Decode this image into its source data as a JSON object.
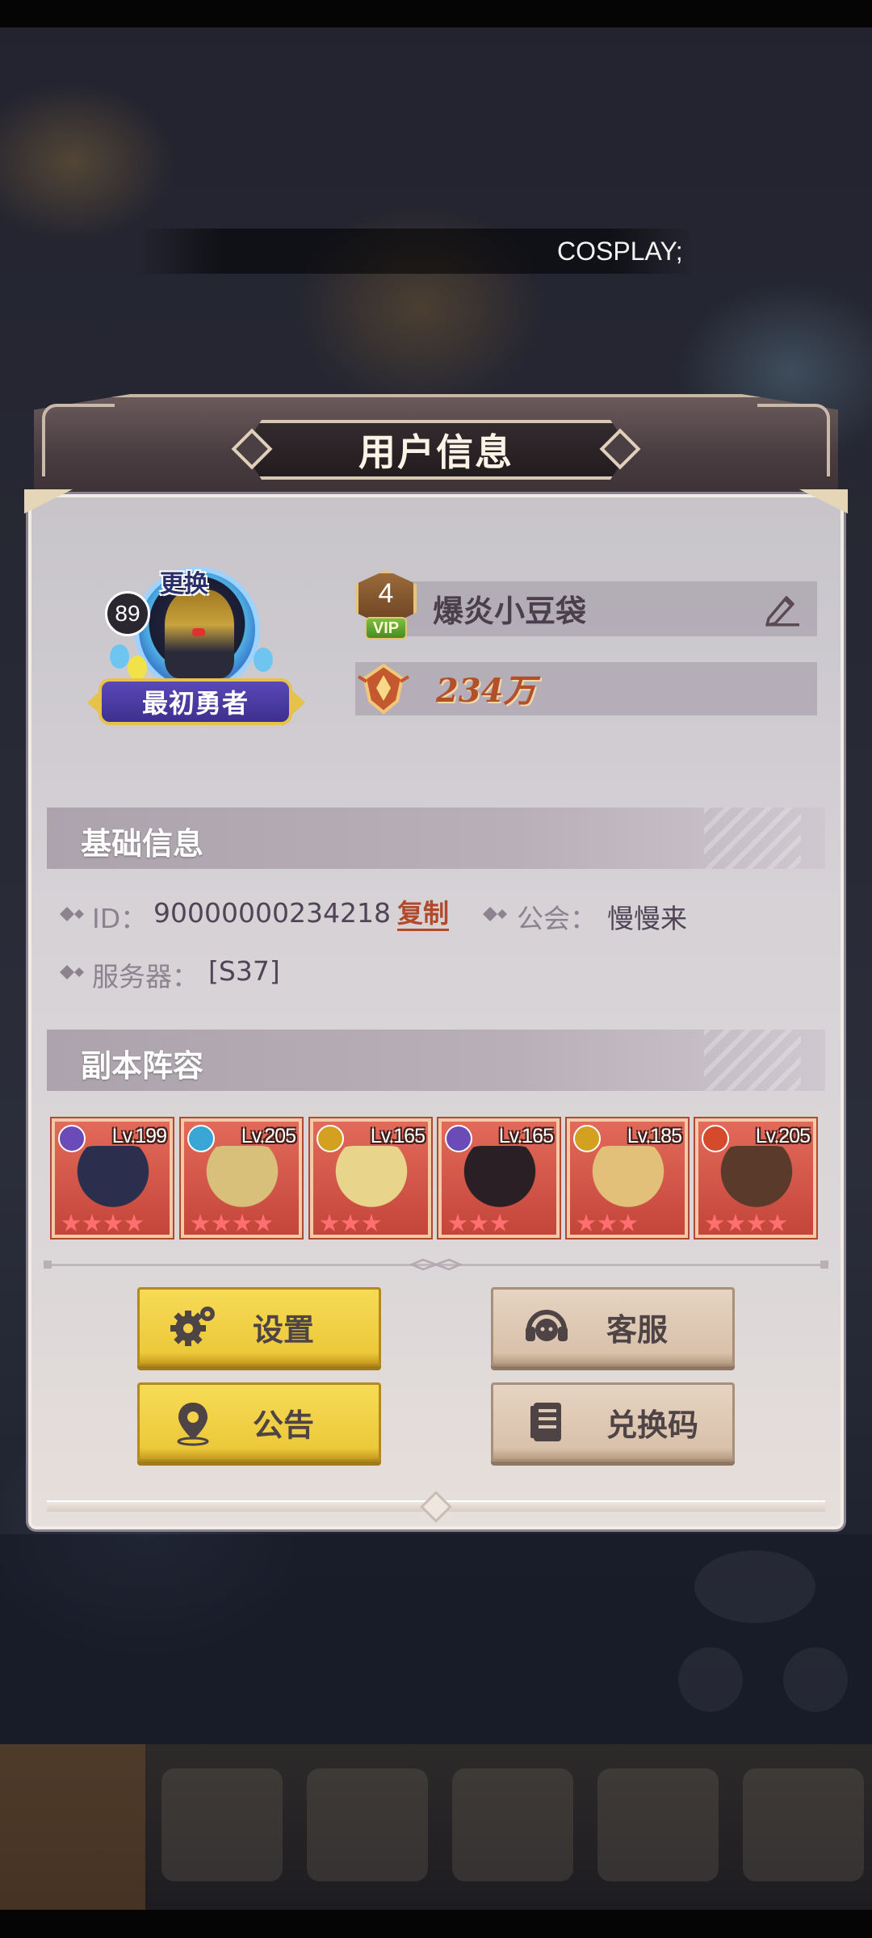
{
  "marquee": {
    "text": "COSPLAY;"
  },
  "panel": {
    "title": "用户信息"
  },
  "profile": {
    "avatar_change_label": "更换",
    "level": "89",
    "honor_title": "最初勇者",
    "vip_level": "4",
    "vip_label": "VIP",
    "nickname": "爆炎小豆袋",
    "edit_icon": "edit-pencil-icon",
    "power_icon": "combat-power-icon",
    "power": "234万"
  },
  "basic_info": {
    "section_title": "基础信息",
    "id_label": "ID：",
    "id_value": "90000000234218",
    "copy_label": "复制",
    "guild_label": "公会：",
    "guild_value": "慢慢来",
    "server_label": "服务器：",
    "server_value": "[S37]"
  },
  "team": {
    "section_title": "副本阵容",
    "heroes": [
      {
        "level": "Lv.199",
        "element": "dark",
        "element_color": "#6a4bb8",
        "portrait_color": "#2b2f4d",
        "stars": 4
      },
      {
        "level": "Lv.205",
        "element": "ice",
        "element_color": "#3aa6d6",
        "portrait_color": "#d9c07a",
        "stars": 4
      },
      {
        "level": "Lv.165",
        "element": "light",
        "element_color": "#d4a020",
        "portrait_color": "#e8d48a",
        "stars": 3
      },
      {
        "level": "Lv.165",
        "element": "dark",
        "element_color": "#6a4bb8",
        "portrait_color": "#2a1f24",
        "stars": 3
      },
      {
        "level": "Lv.185",
        "element": "light",
        "element_color": "#d4a020",
        "portrait_color": "#e2c07a",
        "stars": 3
      },
      {
        "level": "Lv.205",
        "element": "fire",
        "element_color": "#d44a2a",
        "portrait_color": "#5a3a2a",
        "stars": 4
      }
    ]
  },
  "buttons": {
    "settings": {
      "label": "设置",
      "icon": "gear-icon"
    },
    "service": {
      "label": "客服",
      "icon": "headset-icon"
    },
    "notice": {
      "label": "公告",
      "icon": "location-pin-icon"
    },
    "redeem": {
      "label": "兑换码",
      "icon": "book-icon"
    }
  },
  "colors": {
    "button_yellow": "#f2d04a",
    "button_beige": "#e0cab6",
    "copy_link": "#b04a2a",
    "power_text": "#b2502a",
    "card_red": "#d6564a"
  }
}
